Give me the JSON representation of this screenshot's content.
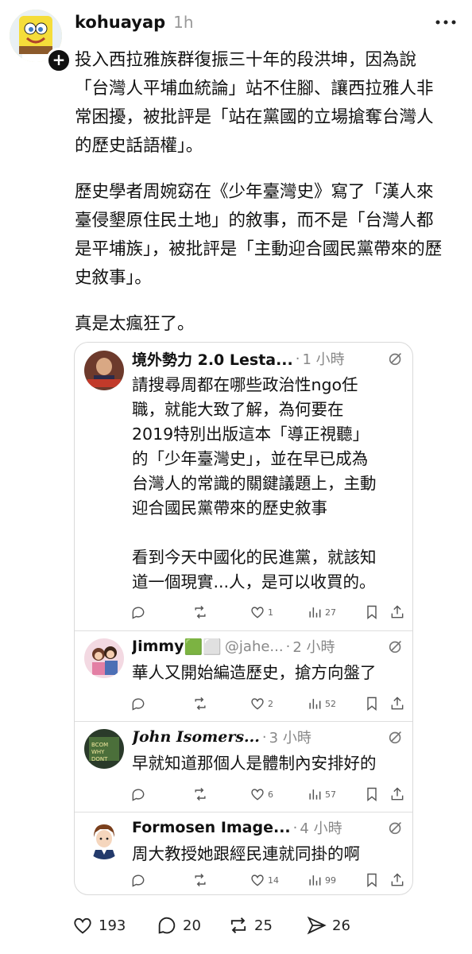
{
  "post": {
    "username": "kohuayap",
    "time": "1h",
    "paragraphs": [
      "投入西拉雅族群復振三十年的段洪坤，因為說「台灣人平埔血統論」站不住腳、讓西拉雅人非常困擾，被批評是「站在黨國的立場搶奪台灣人的歷史話語權」。",
      "歷史學者周婉窈在《少年臺灣史》寫了「漢人來臺侵墾原住民土地」的敘事，而不是「台灣人都是平埔族」，被批評是「主動迎合國民黨帶來的歷史敘事」。",
      "真是太瘋狂了。"
    ],
    "stats": {
      "likes": "193",
      "comments": "20",
      "reposts": "25",
      "shares": "26"
    }
  },
  "quote": {
    "replies": [
      {
        "name": "境外勢力 2.0 Lesta...",
        "handle": "",
        "time": "1 小時",
        "body": "請搜尋周都在哪些政治性ngo任\n職，就能大致了解，為何要在\n2019特別出版這本「導正視聽」\n的「少年臺灣史」，並在早已成為\n台灣人的常識的關鍵議題上，主動\n迎合國民黨帶來的歷史敘事\n\n看到今天中國化的民進黨，就該知\n道一個現實...人，是可以收買的。",
        "likes": "1",
        "views": "27",
        "avatar_label": "境外勢力2.0"
      },
      {
        "name": "Jimmy",
        "flags": "🟩⬜",
        "handle": "@jahe...",
        "time": "2 小時",
        "body": "華人又開始編造歷史，搶方向盤了",
        "likes": "2",
        "views": "52"
      },
      {
        "name": "John Isomers...",
        "handle": "",
        "time": "3 小時",
        "body": "早就知道那個人是體制內安排好的",
        "likes": "6",
        "views": "57"
      },
      {
        "name": "Formosen Image...",
        "handle": "",
        "time": "4 小時",
        "body": "周大教授她跟經民連就同掛的啊",
        "likes": "14",
        "views": "99"
      }
    ]
  },
  "icons": {
    "more": "more-horizontal-icon",
    "grok": "grok-icon",
    "reply": "reply-icon",
    "retweet": "retweet-icon",
    "like": "heart-icon",
    "views": "views-icon",
    "bookmark": "bookmark-icon",
    "share": "share-icon"
  }
}
